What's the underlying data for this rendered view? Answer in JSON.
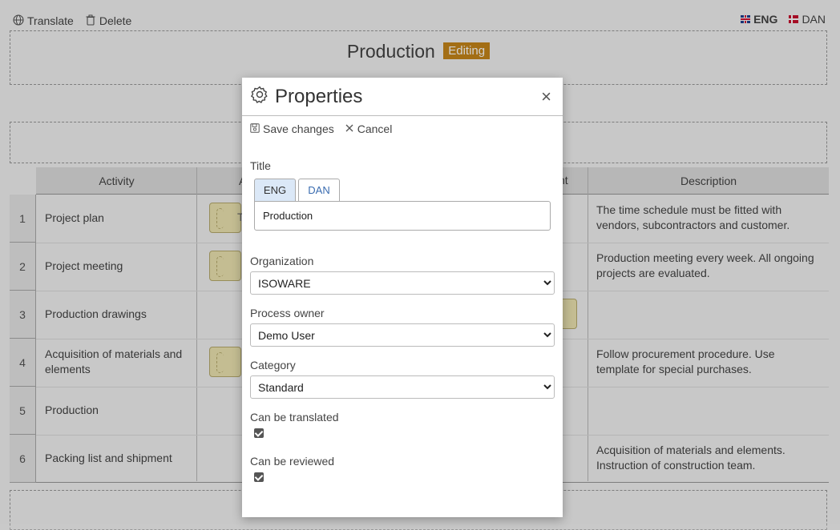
{
  "toolbar": {
    "translate_label": "Translate",
    "delete_label": "Delete"
  },
  "languages": [
    {
      "code": "ENG",
      "active": true,
      "icon": "flag-uk-icon"
    },
    {
      "code": "DAN",
      "active": false,
      "icon": "flag-dk-icon"
    }
  ],
  "page": {
    "title": "Production",
    "status_badge": "Editing"
  },
  "grid": {
    "columns": [
      "Activity",
      "A",
      "nt",
      "Description"
    ],
    "rows": [
      {
        "num": "1",
        "activity": "Project plan",
        "description": "The time schedule must be fitted with vendors, subcontractors and customer."
      },
      {
        "num": "2",
        "activity": "Project meeting",
        "description": "Production meeting every week. All ongoing projects are evaluated."
      },
      {
        "num": "3",
        "activity": "Production drawings",
        "description": ""
      },
      {
        "num": "4",
        "activity": "Acquisition of materials and elements",
        "description": "Follow procurement procedure. Use template for special purchases."
      },
      {
        "num": "5",
        "activity": "Production",
        "description": ""
      },
      {
        "num": "6",
        "activity": "Packing list and shipment",
        "description": "Acquisition of materials and elements. Instruction of construction team."
      }
    ],
    "shape_partial_label": "T"
  },
  "modal": {
    "title": "Properties",
    "close_label": "×",
    "save_label": "Save changes",
    "cancel_label": "Cancel",
    "title_field": {
      "label": "Title",
      "tabs": [
        "ENG",
        "DAN"
      ],
      "active_tab": "ENG",
      "value": "Production"
    },
    "organization": {
      "label": "Organization",
      "value": "ISOWARE"
    },
    "process_owner": {
      "label": "Process owner",
      "value": "Demo User"
    },
    "category": {
      "label": "Category",
      "value": "Standard"
    },
    "can_be_translated": {
      "label": "Can be translated",
      "checked": true
    },
    "can_be_reviewed": {
      "label": "Can be reviewed",
      "checked": true
    }
  }
}
